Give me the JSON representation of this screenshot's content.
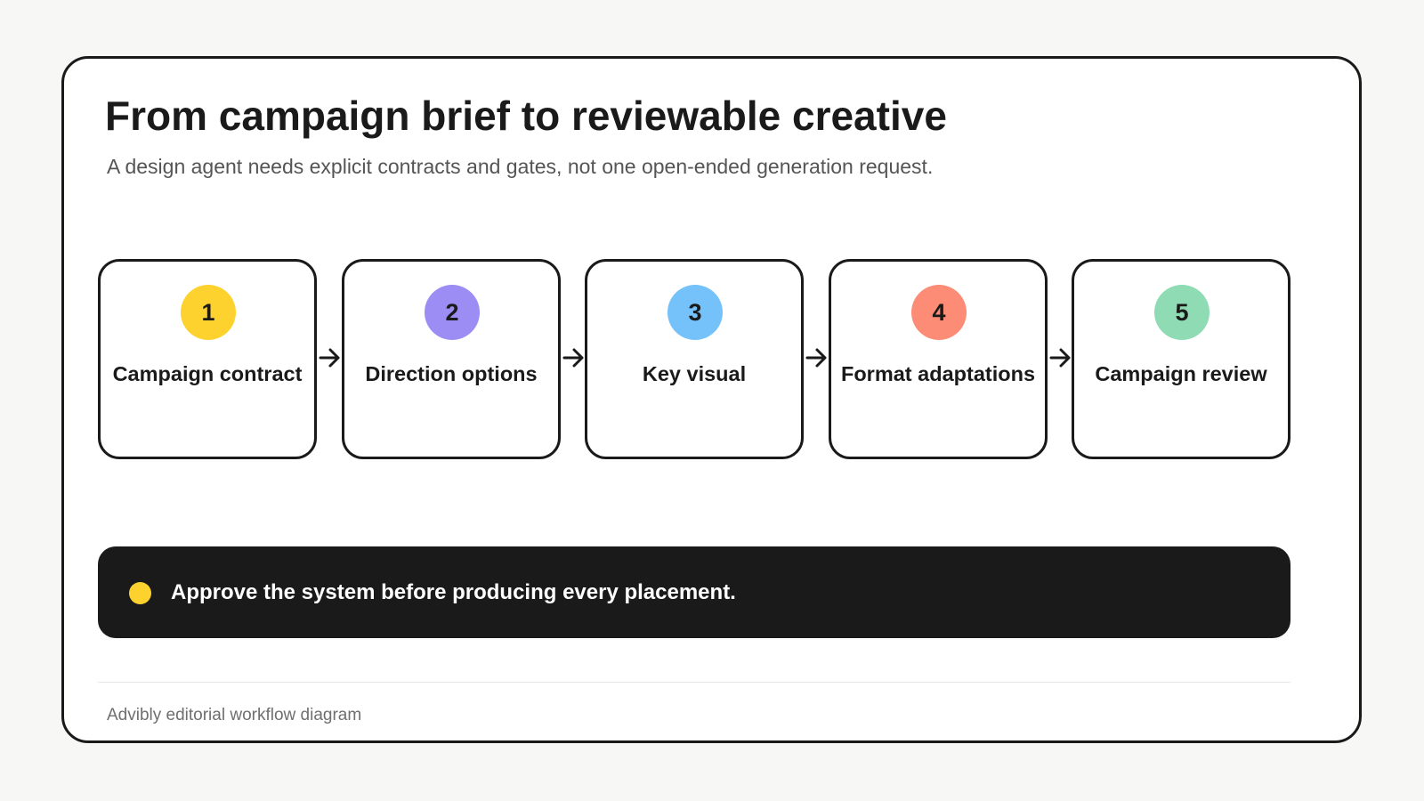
{
  "title": "From campaign brief to reviewable creative",
  "subtitle": "A design agent needs explicit contracts and gates, not one open-ended generation request.",
  "steps": [
    {
      "number": "1",
      "label": "Campaign contract",
      "color": "#fdd22e"
    },
    {
      "number": "2",
      "label": "Direction options",
      "color": "#9b8df3"
    },
    {
      "number": "3",
      "label": "Key visual",
      "color": "#75c2fb"
    },
    {
      "number": "4",
      "label": "Format adaptations",
      "color": "#fd8c76"
    },
    {
      "number": "5",
      "label": "Campaign review",
      "color": "#8fdcb4"
    }
  ],
  "callout": {
    "text": "Approve the system before producing every placement.",
    "dot_color": "#fdd22e",
    "background": "#1a1a1a"
  },
  "footer": "Advibly editorial workflow diagram",
  "arrow_icon": "arrow-right-icon"
}
